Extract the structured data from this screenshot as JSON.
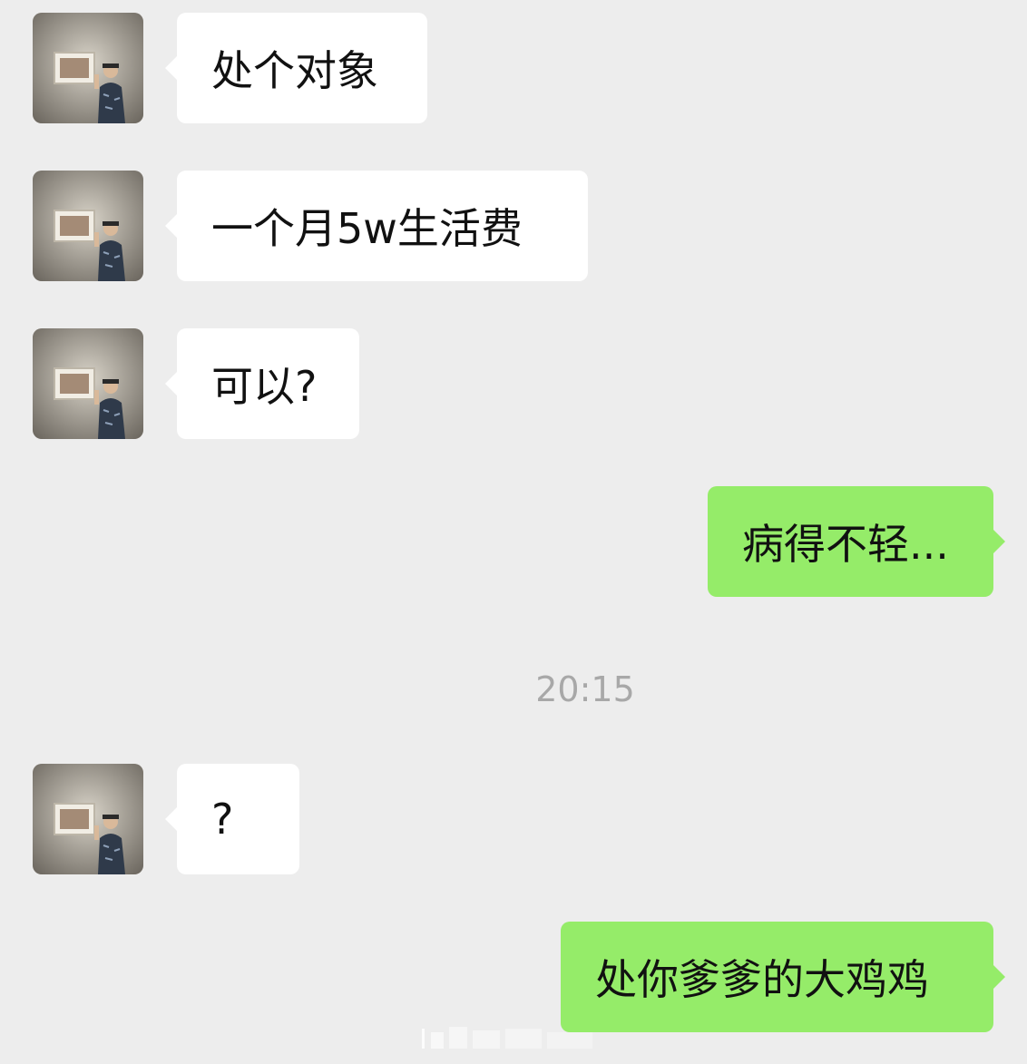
{
  "messages": [
    {
      "side": "in",
      "text": "处个对象",
      "avatar": "contact-avatar"
    },
    {
      "side": "in",
      "text": "一个月5w生活费",
      "avatar": "contact-avatar"
    },
    {
      "side": "in",
      "text": "可以?",
      "avatar": "contact-avatar"
    },
    {
      "side": "out",
      "text": "病得不轻..."
    },
    {
      "side": "in",
      "text": "?",
      "avatar": "contact-avatar"
    },
    {
      "side": "out",
      "text": "处你爹爹的大鸡鸡"
    }
  ],
  "timestamp": "20:15",
  "colors": {
    "background": "#ededed",
    "incoming_bubble": "#ffffff",
    "outgoing_bubble": "#95ec69",
    "timestamp_text": "#a8a8a8"
  }
}
